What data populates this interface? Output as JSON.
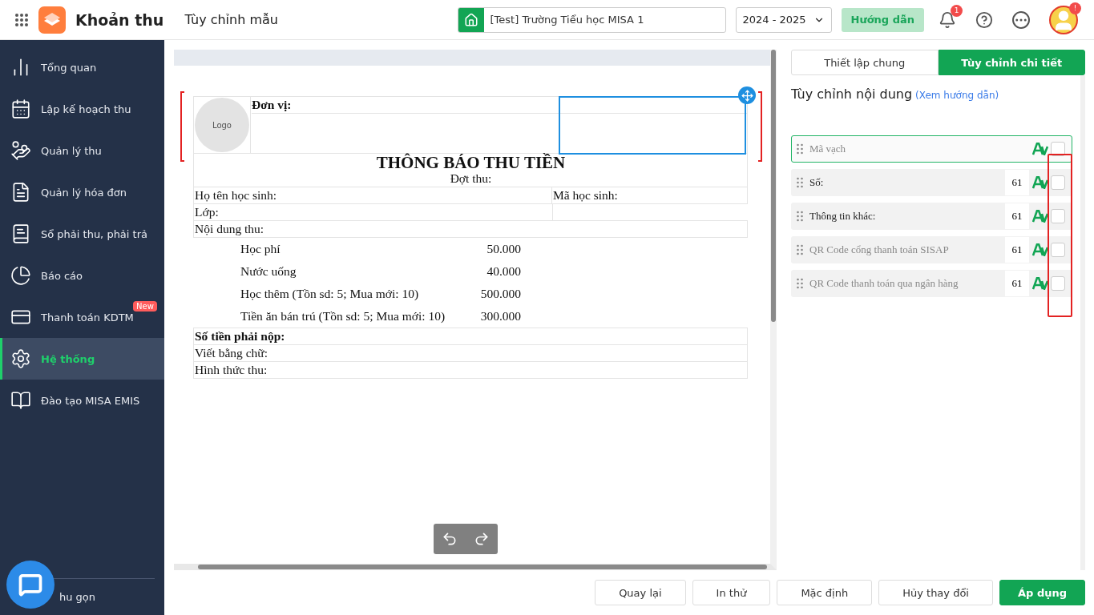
{
  "header": {
    "app_name": "Khoản thu",
    "page_title": "Tùy chỉnh mẫu",
    "school": "[Test] Trường Tiểu học MISA 1",
    "year": "2024 - 2025",
    "guide_button": "Hướng dẫn",
    "notification_count": "1",
    "avatar_badge": "!"
  },
  "sidebar": {
    "items": [
      {
        "label": "Tổng quan",
        "selected": false
      },
      {
        "label": "Lập kế hoạch thu",
        "selected": false
      },
      {
        "label": "Quản lý thu",
        "selected": false
      },
      {
        "label": "Quản lý hóa đơn",
        "selected": false
      },
      {
        "label": "Sổ phải thu, phải trả",
        "selected": false
      },
      {
        "label": "Báo cáo",
        "selected": false
      },
      {
        "label": "Thanh toán KDTM",
        "selected": false,
        "badge": "New"
      },
      {
        "label": "Hệ thống",
        "selected": true
      },
      {
        "label": "Đào tạo MISA EMIS",
        "selected": false
      }
    ],
    "collapse": "hu gọn"
  },
  "document": {
    "logo": "Logo",
    "unit_label": "Đơn vị:",
    "title": "THÔNG BÁO THU TIỀN",
    "batch": "Đợt thu:",
    "student_name": "Họ tên học sinh:",
    "student_code": "Mã học sinh:",
    "class": "Lớp:",
    "content": "Nội dung thu:",
    "fees": [
      {
        "name": "Học phí",
        "amount": "50.000"
      },
      {
        "name": "Nước uống",
        "amount": "40.000"
      },
      {
        "name": "Học thêm (Tồn sd: 5; Mua mới: 10)",
        "amount": "500.000"
      },
      {
        "name": "Tiền ăn bán trú (Tồn sd: 5; Mua mới: 10)",
        "amount": "300.000"
      }
    ],
    "total": "Số tiền phải nộp:",
    "in_words": "Viết bằng chữ:",
    "method": "Hình thức thu:"
  },
  "panel": {
    "tabs": [
      {
        "label": "Thiết lập chung",
        "selected": false
      },
      {
        "label": "Tùy chỉnh chi tiết",
        "selected": true
      }
    ],
    "heading": "Tùy chỉnh nội dung",
    "guide_link": "(Xem hướng dẫn)",
    "fields": [
      {
        "name": "Mã vạch",
        "selected": true,
        "dimmed": true,
        "checked": false
      },
      {
        "name": "Số:",
        "size": "61",
        "selected": false,
        "dimmed": false,
        "checked": false
      },
      {
        "name": "Thông tin khác:",
        "size": "61",
        "selected": false,
        "dimmed": false,
        "checked": false
      },
      {
        "name": "QR Code cổng thanh toán SISAP",
        "size": "61",
        "selected": false,
        "dimmed": true,
        "checked": false
      },
      {
        "name": "QR Code thanh toán qua ngân hàng",
        "size": "61",
        "selected": false,
        "dimmed": true,
        "checked": false
      }
    ]
  },
  "footer_buttons": [
    {
      "label": "Quay lại",
      "kind": "plain"
    },
    {
      "label": "In thử",
      "kind": "plain"
    },
    {
      "label": "Mặc định",
      "kind": "plain"
    },
    {
      "label": "Hủy thay đổi",
      "kind": "plain"
    },
    {
      "label": "Áp dụng",
      "kind": "primary"
    }
  ]
}
